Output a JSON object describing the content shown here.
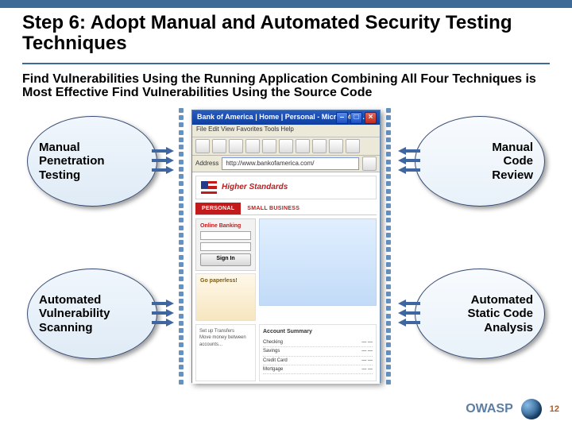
{
  "slide": {
    "title": "Step 6: Adopt Manual and Automated Security Testing Techniques",
    "header_left": "Find Vulnerabilities Using the Running Application",
    "header_mid": "Combining All Four Techniques is Most Effective",
    "header_right": "Find Vulnerabilities Using the Source Code"
  },
  "bubbles": {
    "tl": "Manual\nPenetration\nTesting",
    "bl": "Automated\nVulnerability\nScanning",
    "tr": "Manual\nCode\nReview",
    "br": "Automated\nStatic Code\nAnalysis"
  },
  "browser": {
    "title": "Bank of America | Home | Personal - Microsoft I…",
    "menu": "File   Edit   View   Favorites   Tools   Help",
    "address": "http://www.bankofamerica.com/",
    "banner": "Higher Standards",
    "tab_active": "PERSONAL",
    "tab_inactive": "SMALL BUSINESS",
    "signin_title": "Online Banking",
    "signin_button": "Sign In",
    "promo": "Go paperless!",
    "lower_left": "Set up Transfers\nMove money between accounts...",
    "acct_title": "Account Summary",
    "acct_rows": [
      {
        "name": "Checking",
        "val": "— —"
      },
      {
        "name": "Savings",
        "val": "— —"
      },
      {
        "name": "Credit Card",
        "val": "— —"
      },
      {
        "name": "Mortgage",
        "val": "— —"
      }
    ]
  },
  "footer": {
    "brand": "OWASP",
    "page": "12"
  }
}
